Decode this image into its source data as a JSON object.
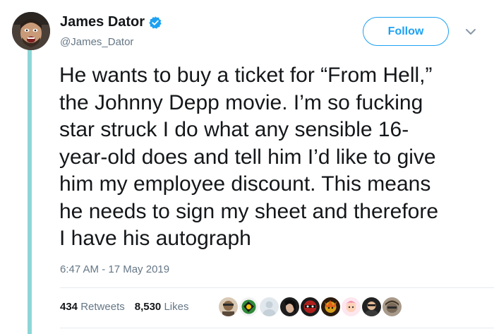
{
  "author": {
    "display_name": "James Dator",
    "handle": "@James_Dator",
    "verified": true,
    "avatar_icon": "user-avatar"
  },
  "follow_button": {
    "label": "Follow"
  },
  "menu_icon": "chevron-down-icon",
  "tweet": {
    "lines": [
      "He wants to buy a ticket for “From Hell,”",
      "the Johnny Depp movie. I’m so fucking",
      "star struck I do what any sensible 16-",
      "year-old does and tell him I’d like to give",
      "him my employee discount. This means",
      "he needs to sign my sheet and therefore",
      "I have his autograph"
    ],
    "timestamp": "6:47 AM - 17 May 2019"
  },
  "stats": {
    "retweets_count": "434",
    "retweets_label": "Retweets",
    "likes_count": "8,530",
    "likes_label": "Likes"
  },
  "likers": [
    {
      "icon": "liker-avatar-1",
      "color": "#8a6a4a"
    },
    {
      "icon": "liker-avatar-2",
      "color": "#2f8a3a"
    },
    {
      "icon": "liker-avatar-3",
      "color": "#c5d0d8"
    },
    {
      "icon": "liker-avatar-4",
      "color": "#1e1e1e"
    },
    {
      "icon": "liker-avatar-5",
      "color": "#b0201c"
    },
    {
      "icon": "liker-avatar-6",
      "color": "#d9a01a"
    },
    {
      "icon": "liker-avatar-7",
      "color": "#f08fb0"
    },
    {
      "icon": "liker-avatar-8",
      "color": "#222222"
    },
    {
      "icon": "liker-avatar-9",
      "color": "#7a6a5a"
    }
  ],
  "colors": {
    "accent": "#1da1f2",
    "thread_line": "#8ed6d6",
    "secondary_text": "#657786",
    "primary_text": "#14171a"
  }
}
